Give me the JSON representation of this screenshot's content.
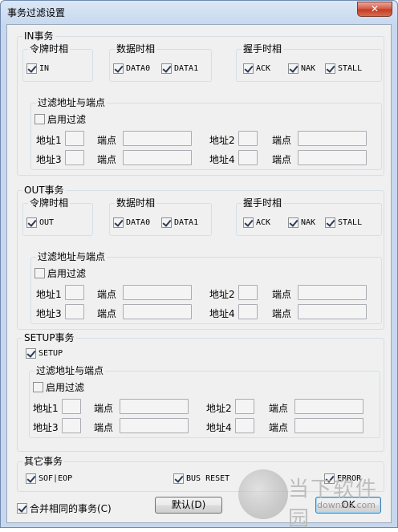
{
  "window": {
    "title": "事务过滤设置",
    "close_label": "✕"
  },
  "in_section": {
    "title": "IN事务",
    "token": {
      "title": "令牌时相",
      "items": [
        {
          "label": "IN",
          "checked": true
        }
      ]
    },
    "data": {
      "title": "数据时相",
      "items": [
        {
          "label": "DATA0",
          "checked": true
        },
        {
          "label": "DATA1",
          "checked": true
        }
      ]
    },
    "handshake": {
      "title": "握手时相",
      "items": [
        {
          "label": "ACK",
          "checked": true
        },
        {
          "label": "NAK",
          "checked": true
        },
        {
          "label": "STALL",
          "checked": true
        }
      ]
    },
    "filter": {
      "title": "过滤地址与端点",
      "enable_label": "启用过滤",
      "enable_checked": false,
      "addr1_label": "地址1",
      "ep1_label": "端点",
      "addr2_label": "地址2",
      "ep2_label": "端点",
      "addr3_label": "地址3",
      "ep3_label": "端点",
      "addr4_label": "地址4",
      "ep4_label": "端点"
    }
  },
  "out_section": {
    "title": "OUT事务",
    "token": {
      "title": "令牌时相",
      "items": [
        {
          "label": "OUT",
          "checked": true
        }
      ]
    },
    "data": {
      "title": "数据时相",
      "items": [
        {
          "label": "DATA0",
          "checked": true
        },
        {
          "label": "DATA1",
          "checked": true
        }
      ]
    },
    "handshake": {
      "title": "握手时相",
      "items": [
        {
          "label": "ACK",
          "checked": true
        },
        {
          "label": "NAK",
          "checked": true
        },
        {
          "label": "STALL",
          "checked": true
        }
      ]
    },
    "filter": {
      "title": "过滤地址与端点",
      "enable_label": "启用过滤",
      "enable_checked": false,
      "addr1_label": "地址1",
      "ep1_label": "端点",
      "addr2_label": "地址2",
      "ep2_label": "端点",
      "addr3_label": "地址3",
      "ep3_label": "端点",
      "addr4_label": "地址4",
      "ep4_label": "端点"
    }
  },
  "setup_section": {
    "title": "SETUP事务",
    "setup": {
      "label": "SETUP",
      "checked": true
    },
    "filter": {
      "title": "过滤地址与端点",
      "enable_label": "启用过滤",
      "enable_checked": false,
      "addr1_label": "地址1",
      "ep1_label": "端点",
      "addr2_label": "地址2",
      "ep2_label": "端点",
      "addr3_label": "地址3",
      "ep3_label": "端点",
      "addr4_label": "地址4",
      "ep4_label": "端点"
    }
  },
  "other_section": {
    "title": "其它事务",
    "items": [
      {
        "label": "SOF|EOP",
        "checked": true
      },
      {
        "label": "BUS RESET",
        "checked": true
      },
      {
        "label": "ERROR",
        "checked": true
      }
    ]
  },
  "merge": {
    "label": "合并相同的事务(C)",
    "checked": true
  },
  "buttons": {
    "default_label": "默认(D)",
    "ok_label": "OK"
  },
  "watermark": {
    "text": "当下软件园",
    "sub": "downxia.com"
  },
  "colors": {
    "window_frame": "#c7d8ee",
    "client_bg": "#f0f0f0",
    "close_red": "#c23a22"
  }
}
